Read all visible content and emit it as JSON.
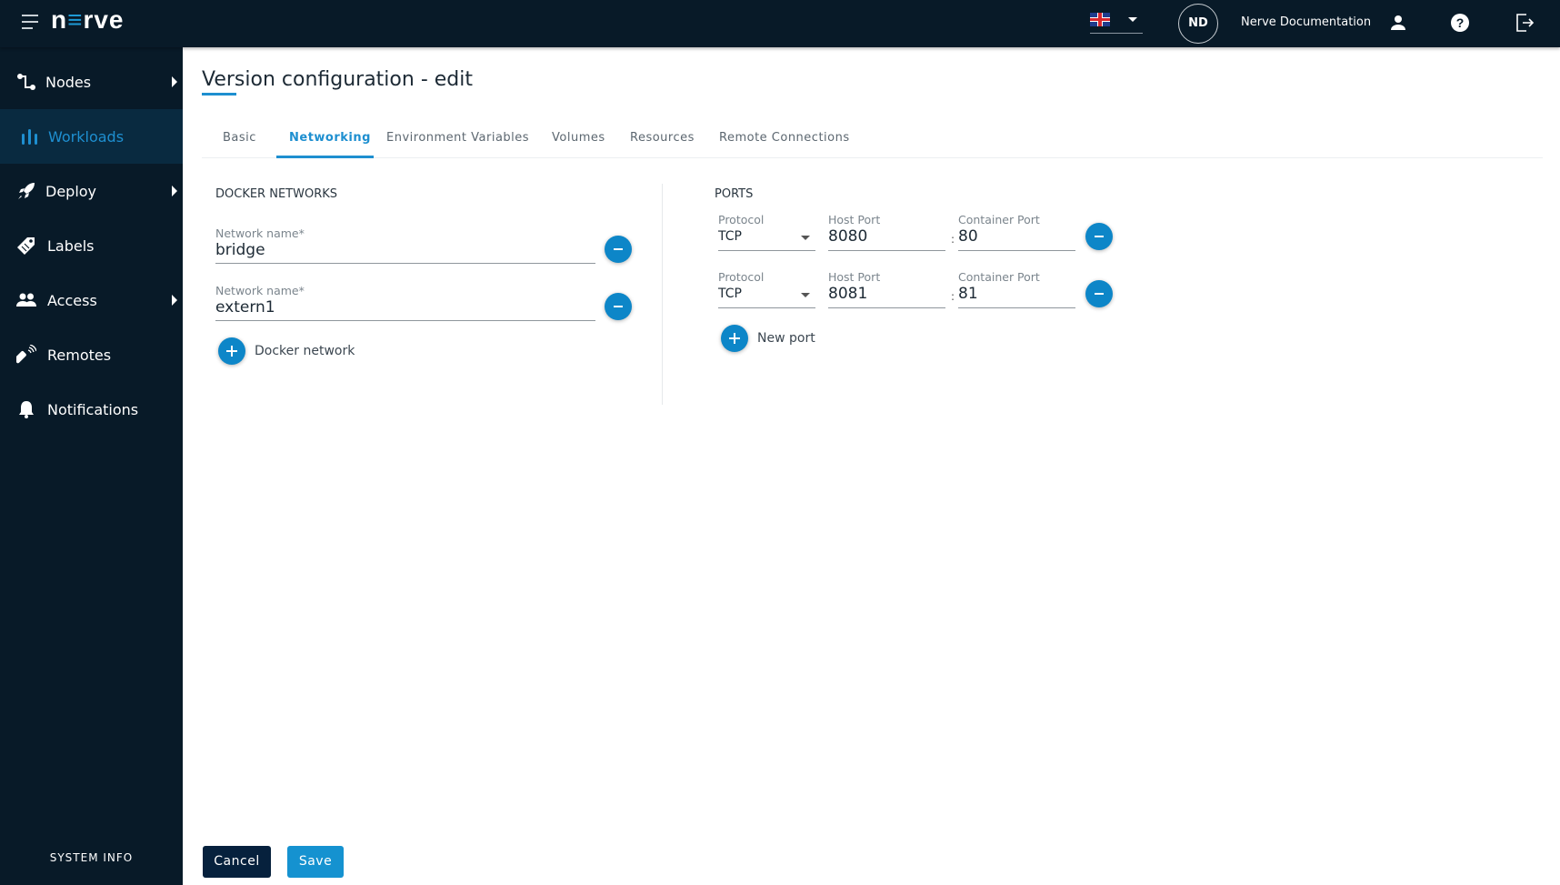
{
  "topbar": {
    "logo_prefix": "n",
    "logo_accent": "≡",
    "logo_suffix": "rve",
    "language_flag": "uk-flag-icon",
    "avatar_initials": "ND",
    "user_name": "Nerve Documentation",
    "icons": [
      "menu-icon",
      "user-icon",
      "help-icon",
      "logout-icon"
    ]
  },
  "sidebar": {
    "items": [
      {
        "label": "Nodes",
        "icon": "nodes-icon",
        "has_submenu": true,
        "active": false
      },
      {
        "label": "Workloads",
        "icon": "workloads-icon",
        "has_submenu": false,
        "active": true
      },
      {
        "label": "Deploy",
        "icon": "rocket-icon",
        "has_submenu": true,
        "active": false
      },
      {
        "label": "Labels",
        "icon": "tag-icon",
        "has_submenu": false,
        "active": false
      },
      {
        "label": "Access",
        "icon": "users-icon",
        "has_submenu": true,
        "active": false
      },
      {
        "label": "Remotes",
        "icon": "remote-icon",
        "has_submenu": false,
        "active": false
      },
      {
        "label": "Notifications",
        "icon": "bell-icon",
        "has_submenu": false,
        "active": false
      }
    ],
    "system_info": "SYSTEM INFO"
  },
  "page": {
    "title": "Version configuration - edit",
    "tabs": [
      {
        "label": "Basic",
        "active": false
      },
      {
        "label": "Networking",
        "active": true
      },
      {
        "label": "Environment Variables",
        "active": false
      },
      {
        "label": "Volumes",
        "active": false
      },
      {
        "label": "Resources",
        "active": false
      },
      {
        "label": "Remote Connections",
        "active": false
      }
    ]
  },
  "docker_networks": {
    "heading": "DOCKER NETWORKS",
    "field_label": "Network name*",
    "networks": [
      "bridge",
      "extern1"
    ],
    "add_label": "Docker network"
  },
  "ports": {
    "heading": "PORTS",
    "protocol_label": "Protocol",
    "host_label": "Host Port",
    "container_label": "Container Port",
    "separator": ":",
    "rows": [
      {
        "protocol": "TCP",
        "host": "8080",
        "container": "80"
      },
      {
        "protocol": "TCP",
        "host": "8081",
        "container": "81"
      }
    ],
    "add_label": "New port"
  },
  "actions": {
    "cancel": "Cancel",
    "save": "Save"
  },
  "colors": {
    "accent": "#1e8fd0",
    "sidebar_bg": "#081a28",
    "cancel_bg": "#06213d",
    "save_bg": "#1592d0"
  }
}
